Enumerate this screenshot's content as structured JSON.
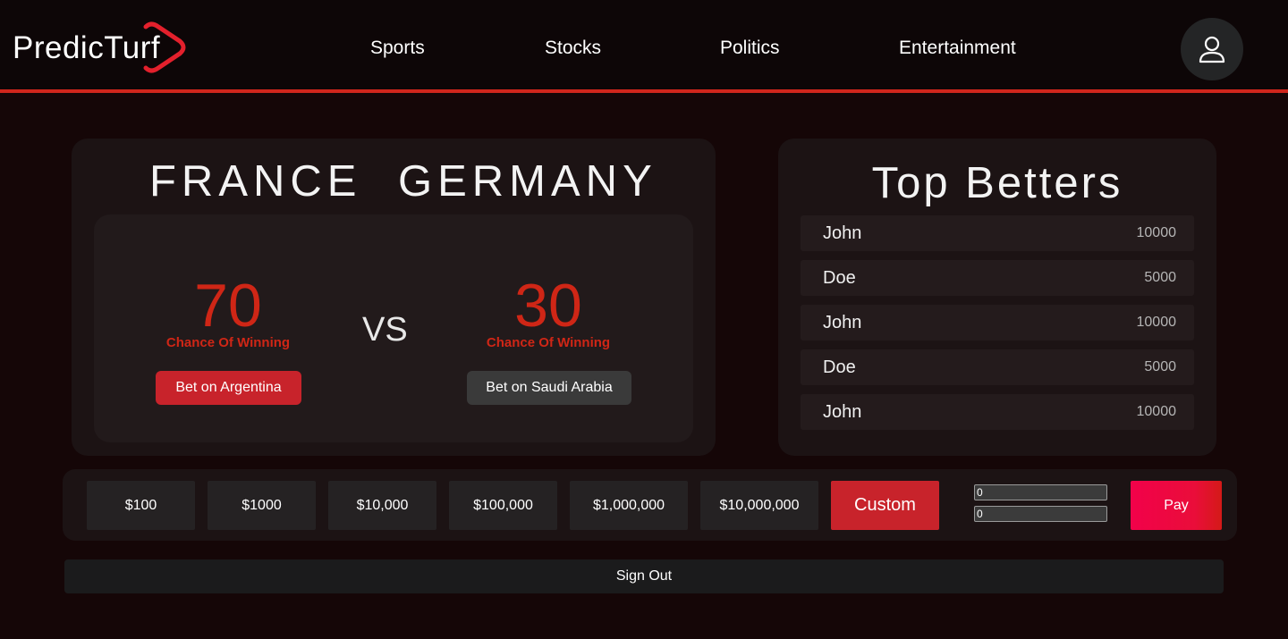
{
  "header": {
    "logo_text": "PredicTurf",
    "nav": [
      "Sports",
      "Stocks",
      "Politics",
      "Entertainment"
    ],
    "profile_icon": "user-icon"
  },
  "match": {
    "team_a": "FRANCE",
    "team_b": "GERMANY",
    "team_a_chance": "70",
    "team_b_chance": "30",
    "chance_label": "Chance Of Winning",
    "vs_label": "VS",
    "bet_a_label": "Bet on Argentina",
    "bet_b_label": "Bet on Saudi Arabia"
  },
  "betters": {
    "title": "Top Betters",
    "rows": [
      {
        "name": "John",
        "score": "10000"
      },
      {
        "name": "Doe",
        "score": "5000"
      },
      {
        "name": "John",
        "score": "10000"
      },
      {
        "name": "Doe",
        "score": "5000"
      },
      {
        "name": "John",
        "score": "10000"
      }
    ]
  },
  "amounts": {
    "options": [
      "$100",
      "$1000",
      "$10,000",
      "$100,000",
      "$1,000,000",
      "$10,000,000"
    ],
    "custom_label": "Custom",
    "input1_value": "0",
    "input2_value": "0",
    "pay_label": "Pay"
  },
  "signout_label": "Sign Out",
  "colors": {
    "accent": "#d0261c",
    "bet_primary": "#c8232b",
    "chance_red": "#cf2616",
    "background": "#150607"
  }
}
